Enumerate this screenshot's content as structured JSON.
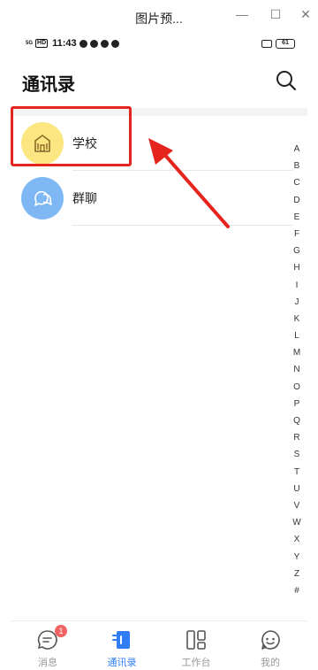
{
  "window": {
    "title": "图片预...",
    "minimize": "—",
    "maximize": "☐",
    "close": "✕"
  },
  "statusbar": {
    "network": "5G",
    "hd": "HD",
    "time": "11:43",
    "battery": "61"
  },
  "header": {
    "title": "通讯录"
  },
  "contacts": [
    {
      "label": "学校",
      "icon": "school-building-icon"
    },
    {
      "label": "群聊",
      "icon": "chat-bubbles-icon"
    }
  ],
  "alpha_index": [
    "A",
    "B",
    "C",
    "D",
    "E",
    "F",
    "G",
    "H",
    "I",
    "J",
    "K",
    "L",
    "M",
    "N",
    "O",
    "P",
    "Q",
    "R",
    "S",
    "T",
    "U",
    "V",
    "W",
    "X",
    "Y",
    "Z",
    "#"
  ],
  "tabs": [
    {
      "label": "消息",
      "badge": "1",
      "icon": "message-icon"
    },
    {
      "label": "通讯录",
      "icon": "contacts-icon",
      "active": true
    },
    {
      "label": "工作台",
      "icon": "workbench-icon"
    },
    {
      "label": "我的",
      "icon": "profile-icon"
    }
  ],
  "colors": {
    "accent": "#2f7ef5",
    "highlight": "#e5241e",
    "school_avatar": "#fce681",
    "group_avatar": "#7fb7f4",
    "badge": "#f06464"
  }
}
